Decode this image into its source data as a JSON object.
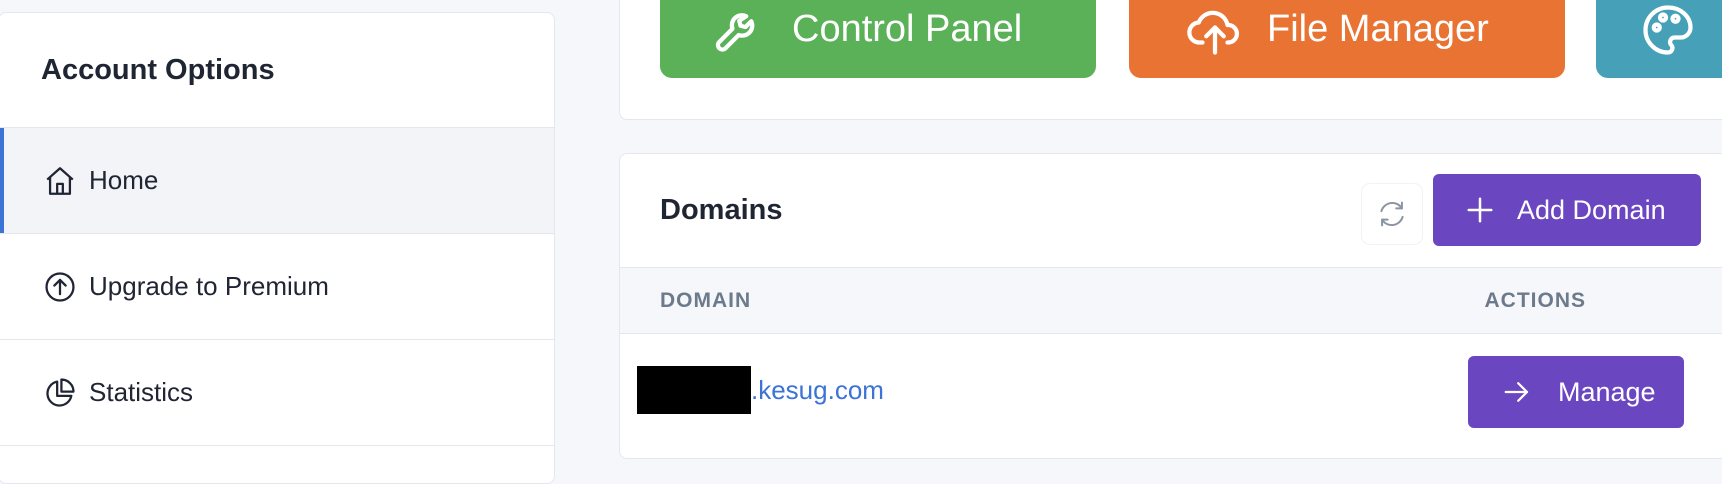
{
  "sidebar": {
    "title": "Account Options",
    "items": [
      {
        "label": "Home",
        "icon": "home-icon",
        "active": true
      },
      {
        "label": "Upgrade to Premium",
        "icon": "arrow-up-circle-icon",
        "active": false
      },
      {
        "label": "Statistics",
        "icon": "pie-chart-icon",
        "active": false
      }
    ]
  },
  "quick_access": {
    "buttons": [
      {
        "label": "Control Panel",
        "icon": "wrench-icon",
        "color": "#5bb158"
      },
      {
        "label": "File Manager",
        "icon": "cloud-upload-icon",
        "color": "#e87332"
      },
      {
        "label": "",
        "icon": "palette-icon",
        "color": "#46a1b8"
      }
    ]
  },
  "domains": {
    "title": "Domains",
    "refresh_icon": "refresh-icon",
    "add_button_label": "Add Domain",
    "columns": {
      "domain": "DOMAIN",
      "actions": "ACTIONS"
    },
    "rows": [
      {
        "domain": ".kesug.com",
        "action_label": "Manage"
      }
    ]
  },
  "colors": {
    "accent": "#6b46c1",
    "link": "#3b73d6",
    "active_indicator": "#3b73d6"
  }
}
